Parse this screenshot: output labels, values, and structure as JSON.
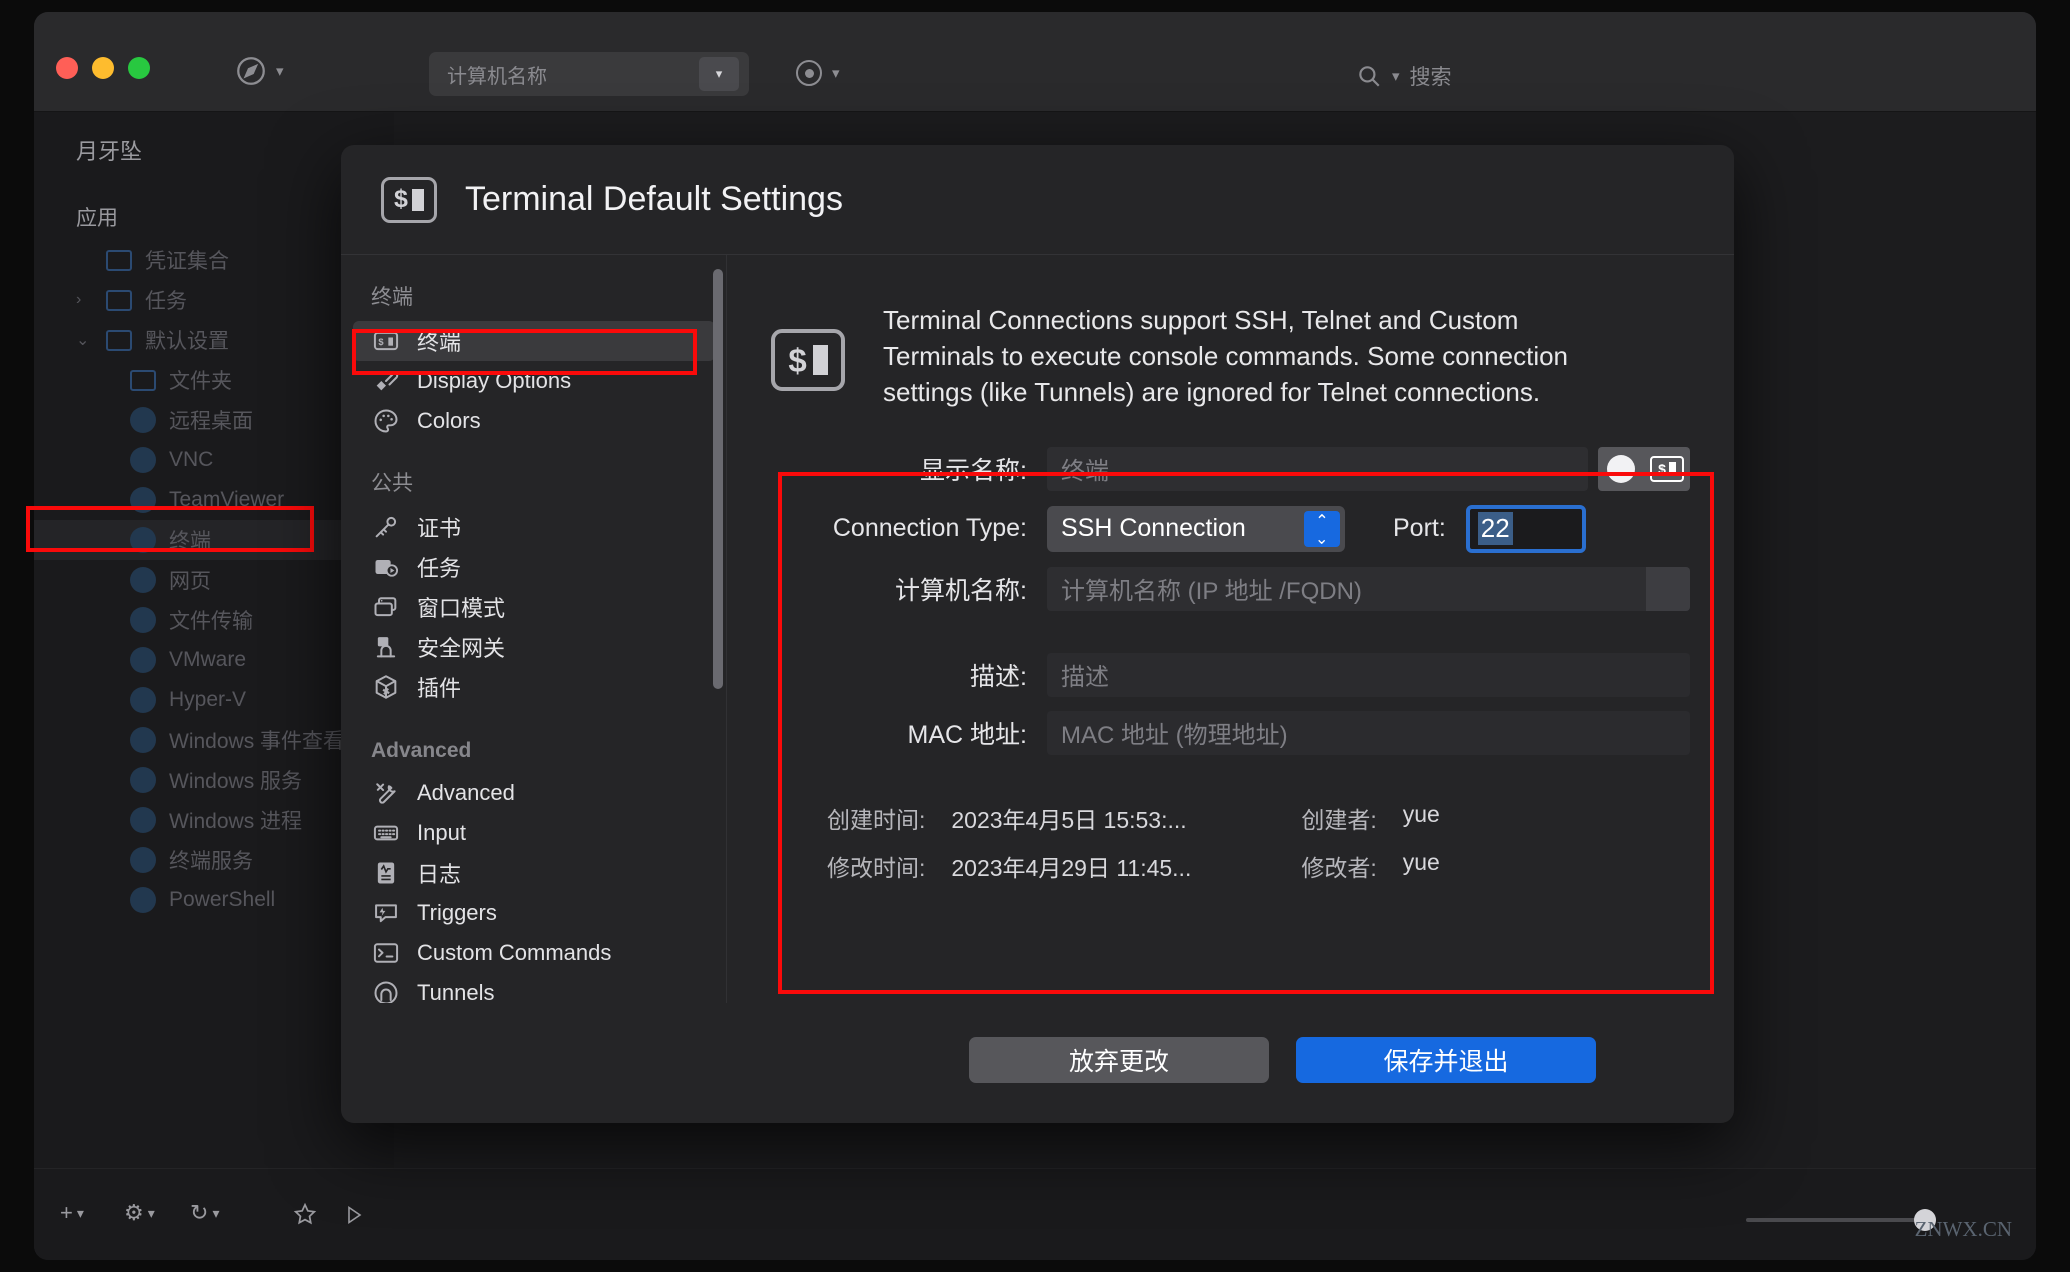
{
  "app": {
    "toolbar": {
      "computer_name_combo": "计算机名称",
      "search_placeholder": "搜索",
      "nav_icon": "compass-icon",
      "record_icon": "record-icon"
    },
    "sidebar": {
      "title": "月牙坠",
      "groups": [
        {
          "label": "应用",
          "items": [
            {
              "label": "凭证集合",
              "icon": "folder-icon",
              "indent": 1,
              "arrow": ""
            },
            {
              "label": "任务",
              "icon": "folder-icon",
              "indent": 1,
              "arrow": "›"
            },
            {
              "label": "默认设置",
              "icon": "folder-icon",
              "indent": 1,
              "arrow": "⌄"
            },
            {
              "label": "文件夹",
              "icon": "folder-icon",
              "indent": 2,
              "arrow": ""
            },
            {
              "label": "远程桌面",
              "icon": "globe-icon",
              "indent": 2,
              "arrow": ""
            },
            {
              "label": "VNC",
              "icon": "globe-icon",
              "indent": 2,
              "arrow": ""
            },
            {
              "label": "TeamViewer",
              "icon": "globe-icon",
              "indent": 2,
              "arrow": ""
            },
            {
              "label": "终端",
              "icon": "terminal-icon",
              "indent": 2,
              "arrow": "",
              "highlight": true
            },
            {
              "label": "网页",
              "icon": "globe-icon",
              "indent": 2,
              "arrow": ""
            },
            {
              "label": "文件传输",
              "icon": "globe-icon",
              "indent": 2,
              "arrow": ""
            },
            {
              "label": "VMware",
              "icon": "globe-icon",
              "indent": 2,
              "arrow": ""
            },
            {
              "label": "Hyper-V",
              "icon": "globe-icon",
              "indent": 2,
              "arrow": ""
            },
            {
              "label": "Windows 事件查看",
              "icon": "globe-icon",
              "indent": 2,
              "arrow": ""
            },
            {
              "label": "Windows 服务",
              "icon": "globe-icon",
              "indent": 2,
              "arrow": ""
            },
            {
              "label": "Windows 进程",
              "icon": "globe-icon",
              "indent": 2,
              "arrow": ""
            },
            {
              "label": "终端服务",
              "icon": "globe-icon",
              "indent": 2,
              "arrow": ""
            },
            {
              "label": "PowerShell",
              "icon": "globe-icon",
              "indent": 2,
              "arrow": ""
            }
          ]
        }
      ]
    },
    "bottombar": {
      "add_label": "+",
      "gear_label": "⚙",
      "history_label": "↻",
      "star_icon": "star-icon",
      "play_icon": "play-icon",
      "watermark": "ZNWX.CN"
    }
  },
  "dialog": {
    "title": "Terminal Default Settings",
    "title_icon": "terminal-icon",
    "nav": [
      {
        "group": "终端",
        "items": [
          {
            "label": "终端",
            "icon": "terminal-icon",
            "active": true
          },
          {
            "label": "Display Options",
            "icon": "brush-icon",
            "active": false
          },
          {
            "label": "Colors",
            "icon": "palette-icon",
            "active": false
          }
        ]
      },
      {
        "group": "公共",
        "items": [
          {
            "label": "证书",
            "icon": "key-icon",
            "active": false
          },
          {
            "label": "任务",
            "icon": "task-play-icon",
            "active": false
          },
          {
            "label": "窗口模式",
            "icon": "windows-icon",
            "active": false
          },
          {
            "label": "安全网关",
            "icon": "gateway-icon",
            "active": false
          },
          {
            "label": "插件",
            "icon": "package-icon",
            "active": false
          }
        ]
      },
      {
        "group": "Advanced",
        "items": [
          {
            "label": "Advanced",
            "icon": "tools-icon",
            "active": false
          },
          {
            "label": "Input",
            "icon": "keyboard-icon",
            "active": false
          },
          {
            "label": "日志",
            "icon": "log-icon",
            "active": false
          },
          {
            "label": "Triggers",
            "icon": "trigger-icon",
            "active": false
          },
          {
            "label": "Custom Commands",
            "icon": "command-prompt-icon",
            "active": false
          },
          {
            "label": "Tunnels",
            "icon": "tunnel-icon",
            "active": false
          }
        ]
      }
    ],
    "intro": {
      "icon": "terminal-icon",
      "text": "Terminal Connections support SSH, Telnet and Custom Terminals to execute console commands. Some connection settings (like Tunnels) are ignored for Telnet connections."
    },
    "form": {
      "display_name": {
        "label": "显示名称:",
        "value": "终端",
        "placeholder": "终端"
      },
      "connection_type": {
        "label": "Connection Type:",
        "value": "SSH Connection"
      },
      "port": {
        "label": "Port:",
        "value": "22"
      },
      "computer_name": {
        "label": "计算机名称:",
        "placeholder": "计算机名称 (IP 地址 /FQDN)"
      },
      "description": {
        "label": "描述:",
        "placeholder": "描述"
      },
      "mac_address": {
        "label": "MAC 地址:",
        "placeholder": "MAC 地址 (物理地址)"
      }
    },
    "meta": {
      "created_time_label": "创建时间:",
      "created_time_value": "2023年4月5日 15:53:...",
      "modified_time_label": "修改时间:",
      "modified_time_value": "2023年4月29日 11:45...",
      "creator_label": "创建者:",
      "creator_value": "yue",
      "modifier_label": "修改者:",
      "modifier_value": "yue"
    },
    "footer": {
      "discard_label": "放弃更改",
      "save_label": "保存并退出"
    }
  },
  "colors": {
    "accent_blue": "#1669e0",
    "highlight_red": "#fa0a0a",
    "dialog_bg": "#252527"
  }
}
